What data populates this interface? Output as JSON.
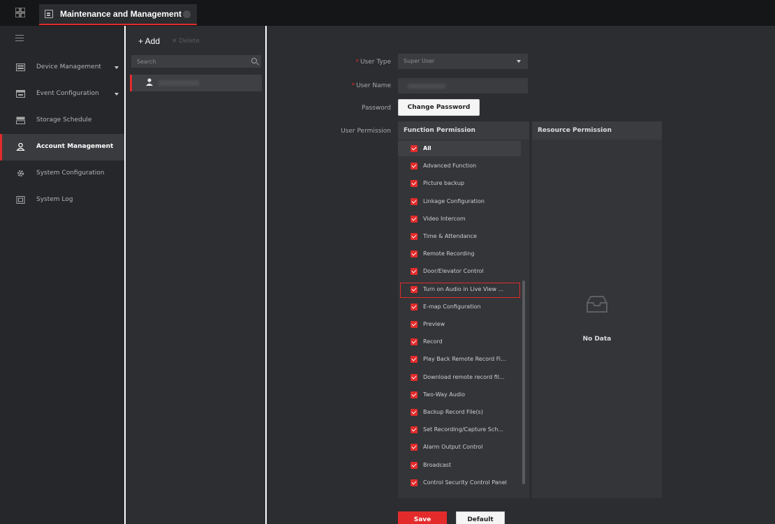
{
  "titlebar": {
    "tab_title": "Maintenance and Management"
  },
  "sidebar": {
    "items": [
      {
        "label": "Device Management",
        "icon": "device-icon",
        "has_arrow": true,
        "active": false
      },
      {
        "label": "Event Configuration",
        "icon": "event-icon",
        "has_arrow": true,
        "active": false
      },
      {
        "label": "Storage Schedule",
        "icon": "storage-icon",
        "has_arrow": false,
        "active": false
      },
      {
        "label": "Account Management",
        "icon": "user-icon",
        "has_arrow": false,
        "active": true
      },
      {
        "label": "System Configuration",
        "icon": "gear-icon",
        "has_arrow": false,
        "active": false
      },
      {
        "label": "System Log",
        "icon": "log-icon",
        "has_arrow": false,
        "active": false
      }
    ]
  },
  "userpanel": {
    "add_label": "+ Add",
    "delete_label": "✕ Delete",
    "search_placeholder": "Search"
  },
  "form": {
    "user_type_label": "User Type",
    "user_type_value": "Super User",
    "user_name_label": "User Name",
    "password_label": "Password",
    "change_password_label": "Change Password",
    "user_permission_label": "User Permission"
  },
  "function_permission": {
    "header": "Function Permission",
    "items": [
      "All",
      "Advanced Function",
      "Picture backup",
      "Linkage Configuration",
      "Video Intercom",
      "Time & Attendance",
      "Remote Recording",
      "Door/Elevator Control",
      "Turn on Audio in Live View ...",
      "E-map Configuration",
      "Preview",
      "Record",
      "Play Back Remote Record Fi...",
      "Download remote record fil...",
      "Two-Way Audio",
      "Backup Record File(s)",
      "Set Recording/Capture Sch...",
      "Alarm Output Control",
      "Broadcast",
      "Control Security Control Panel"
    ]
  },
  "resource_permission": {
    "header": "Resource Permission",
    "empty_text": "No Data"
  },
  "actions": {
    "save_label": "Save",
    "default_label": "Default"
  },
  "colors": {
    "accent": "#e32b2b",
    "background": "#2b2d30",
    "sidebar": "#25272a"
  }
}
